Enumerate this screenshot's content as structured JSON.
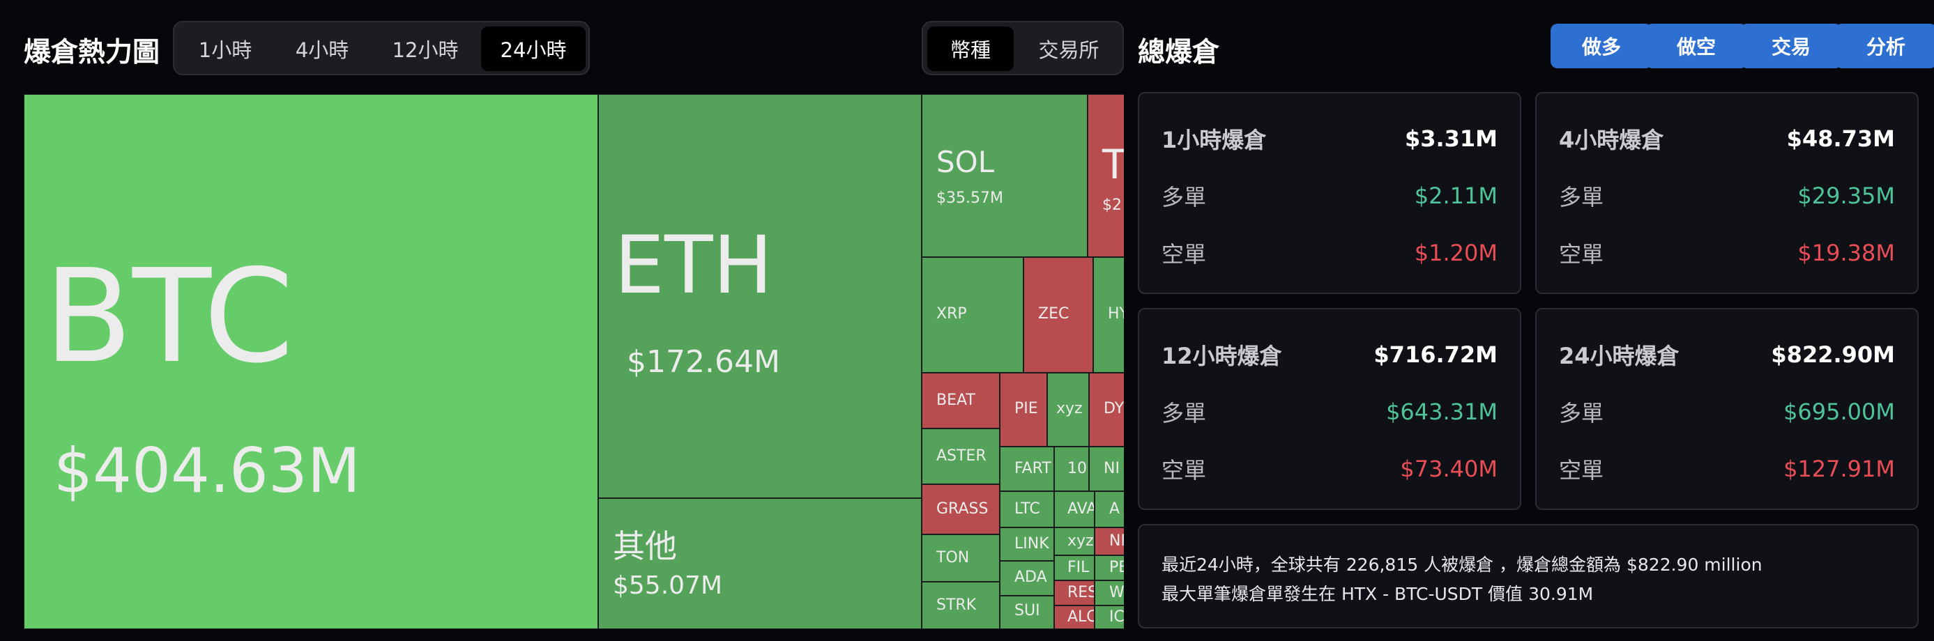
{
  "heatmap": {
    "title": "爆倉熱力圖",
    "time_tabs": [
      {
        "label": "1小時",
        "active": false
      },
      {
        "label": "4小時",
        "active": false
      },
      {
        "label": "12小時",
        "active": false
      },
      {
        "label": "24小時",
        "active": true
      }
    ],
    "group_tabs": [
      {
        "label": "幣種",
        "active": true
      },
      {
        "label": "交易所",
        "active": false
      }
    ],
    "colors": {
      "long_strong": "#66cc6a",
      "long": "#55a25a",
      "short": "#b74d4e"
    },
    "tiles": [
      {
        "symbol": "BTC",
        "value": "$404.63M",
        "side": "long"
      },
      {
        "symbol": "ETH",
        "value": "$172.64M",
        "side": "long"
      },
      {
        "symbol": "其他",
        "value": "$55.07M",
        "side": "long"
      },
      {
        "symbol": "SOL",
        "value": "$35.57M",
        "side": "long"
      },
      {
        "symbol": "T",
        "value": "$2",
        "side": "short"
      },
      {
        "symbol": "XRP",
        "side": "long"
      },
      {
        "symbol": "ZEC",
        "side": "short"
      },
      {
        "symbol": "HY",
        "side": "long"
      },
      {
        "symbol": "BEAT",
        "side": "short"
      },
      {
        "symbol": "PIE",
        "side": "short"
      },
      {
        "symbol": "xyz",
        "side": "long"
      },
      {
        "symbol": "DY",
        "side": "short"
      },
      {
        "symbol": "ASTER",
        "side": "long"
      },
      {
        "symbol": "FART",
        "side": "long"
      },
      {
        "symbol": "10",
        "side": "long"
      },
      {
        "symbol": "NI",
        "side": "long"
      },
      {
        "symbol": "GRASS",
        "side": "short"
      },
      {
        "symbol": "LTC",
        "side": "long"
      },
      {
        "symbol": "AVA",
        "side": "long"
      },
      {
        "symbol": "A",
        "side": "long"
      },
      {
        "symbol": "xyz",
        "side": "long"
      },
      {
        "symbol": "NN",
        "side": "short"
      },
      {
        "symbol": "TON",
        "side": "long"
      },
      {
        "symbol": "LINK",
        "side": "long"
      },
      {
        "symbol": "FIL",
        "side": "long"
      },
      {
        "symbol": "PE",
        "side": "long"
      },
      {
        "symbol": "ADA",
        "side": "long"
      },
      {
        "symbol": "RES",
        "side": "short"
      },
      {
        "symbol": "WA",
        "side": "long"
      },
      {
        "symbol": "STRK",
        "side": "long"
      },
      {
        "symbol": "SUI",
        "side": "long"
      },
      {
        "symbol": "ALC",
        "side": "short"
      },
      {
        "symbol": "IC",
        "side": "long"
      }
    ]
  },
  "total": {
    "title": "總爆倉",
    "buttons": [
      "做多",
      "做空",
      "交易",
      "分析"
    ],
    "cards": [
      {
        "period": "1小時爆倉",
        "total": "$3.31M",
        "long_label": "多單",
        "long": "$2.11M",
        "short_label": "空單",
        "short": "$1.20M"
      },
      {
        "period": "4小時爆倉",
        "total": "$48.73M",
        "long_label": "多單",
        "long": "$29.35M",
        "short_label": "空單",
        "short": "$19.38M"
      },
      {
        "period": "12小時爆倉",
        "total": "$716.72M",
        "long_label": "多單",
        "long": "$643.31M",
        "short_label": "空單",
        "short": "$73.40M"
      },
      {
        "period": "24小時爆倉",
        "total": "$822.90M",
        "long_label": "多單",
        "long": "$695.00M",
        "short_label": "空單",
        "short": "$127.91M"
      }
    ],
    "colors": {
      "long": "#4fc39a",
      "short": "#ea4d55"
    },
    "summary_line1": "最近24小時，全球共有 226,815 人被爆倉 ，爆倉總金額為 $822.90 million",
    "summary_line2": "最大單筆爆倉單發生在 HTX - BTC-USDT 價值 30.91M"
  }
}
